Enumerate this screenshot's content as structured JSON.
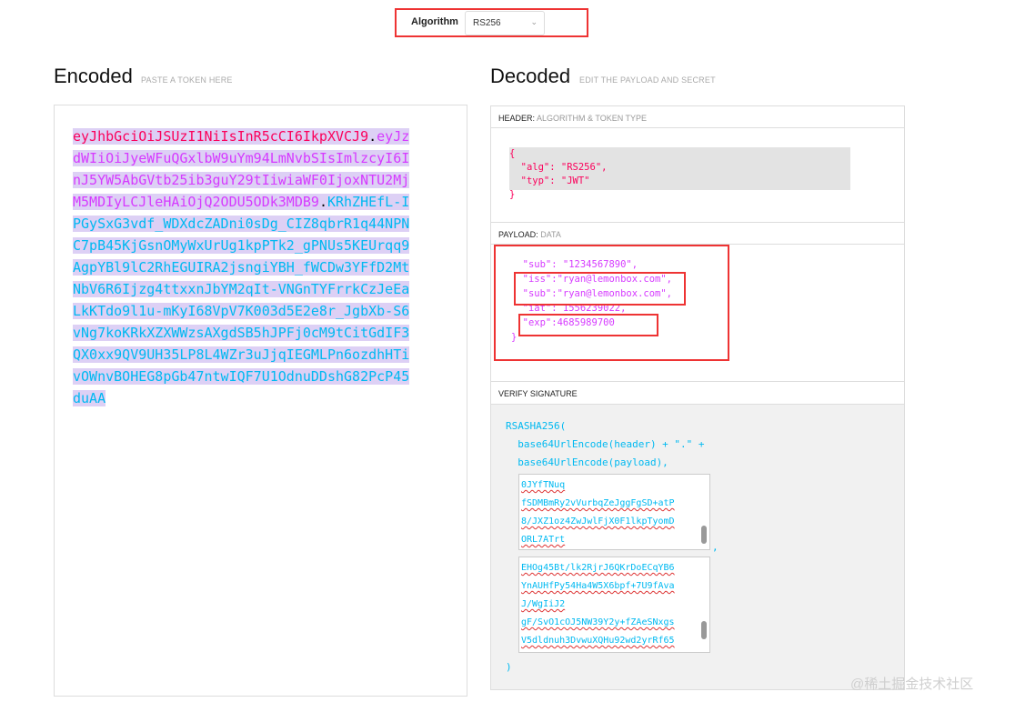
{
  "algorithm": {
    "label": "Algorithm",
    "value": "RS256"
  },
  "encoded": {
    "title": "Encoded",
    "subtitle": "PASTE A TOKEN HERE",
    "token_header": "eyJhbGciOiJSUzI1NiIsInR5cCI6IkpXVCJ9",
    "dot1": ".",
    "token_payload": "eyJzdWIiOiJyeWFuQGxlbW9uYm94LmNvbSIsImlzcyI6InJ5YW5AbGVtb25ib3guY29tIiwiaWF0IjoxNTU2MjM5MDIyLCJleHAiOjQ2ODU5ODk3MDB9",
    "dot2": ".",
    "token_signature": "KRhZHEfL-IPGySxG3vdf_WDXdcZADni0sDg_CIZ8qbrR1q44NPNC7pB45KjGsnOMyWxUrUg1kpPTk2_gPNUs5KEUrqq9AgpYBl9lC2RhEGUIRA2jsngiYBH_fWCDw3YFfD2MtNbV6R6Ijzg4ttxxnJbYM2qIt-VNGnTYFrrkCzJeEaLkKTdo9l1u-mKyI68VpV7K003d5E2e8r_JgbXb-S6vNg7koKRkXZXWWzsAXgdSB5hJPFj0cM9tCitGdIF3QX0xx9QV9UH35LP8L4WZr3uJjqIEGMLPn6ozdhHTivOWnvBOHEG8pGb47ntwIQF7U1OdnuDDshG82PcP45duAA"
  },
  "decoded": {
    "title": "Decoded",
    "subtitle": "EDIT THE PAYLOAD AND SECRET",
    "header_label": "HEADER:",
    "header_sub": "ALGORITHM & TOKEN TYPE",
    "header_json": "{\n  \"alg\": \"RS256\",\n  \"typ\": \"JWT\"\n}",
    "payload_label": "PAYLOAD:",
    "payload_sub": "DATA",
    "payload_json": "  \"sub\": \"1234567890\",\n  \"iss\":\"ryan@lemonbox.com\",\n  \"sub\":\"ryan@lemonbox.com\",\n  \"iat\": 1556239022,\n  \"exp\":4685989700\n}",
    "verify_label": "VERIFY SIGNATURE",
    "verify_code": "RSASHA256(\n  base64UrlEncode(header) + \".\" +\n  base64UrlEncode(payload),",
    "verify_close": ")",
    "comma": ",",
    "public_key_lines": [
      "0JYfTNuq",
      "fSDMBmRy2vVurbqZeJggFgSD+atP",
      "8/JXZ1oz4ZwJwlFjX0F1lkpTyomD",
      "ORL7ATrt"
    ],
    "private_key_lines": [
      "EHOg45Bt/lk2RjrJ6QKrDoECqYB6",
      "YnAUHfPy54Ha4W5X6bpf+7U9fAva",
      "J/WgIiJ2",
      "gF/SvO1cOJ5NW39Y2y+fZAeSNxgs",
      "V5dldnuh3DvwuXQHu92wd2yrRf65"
    ]
  },
  "watermark": "@稀土掘金技术社区",
  "colors": {
    "header": "#fb015b",
    "payload": "#d63aff",
    "signature": "#00b9f1",
    "highlight_box": "#ee3333"
  }
}
